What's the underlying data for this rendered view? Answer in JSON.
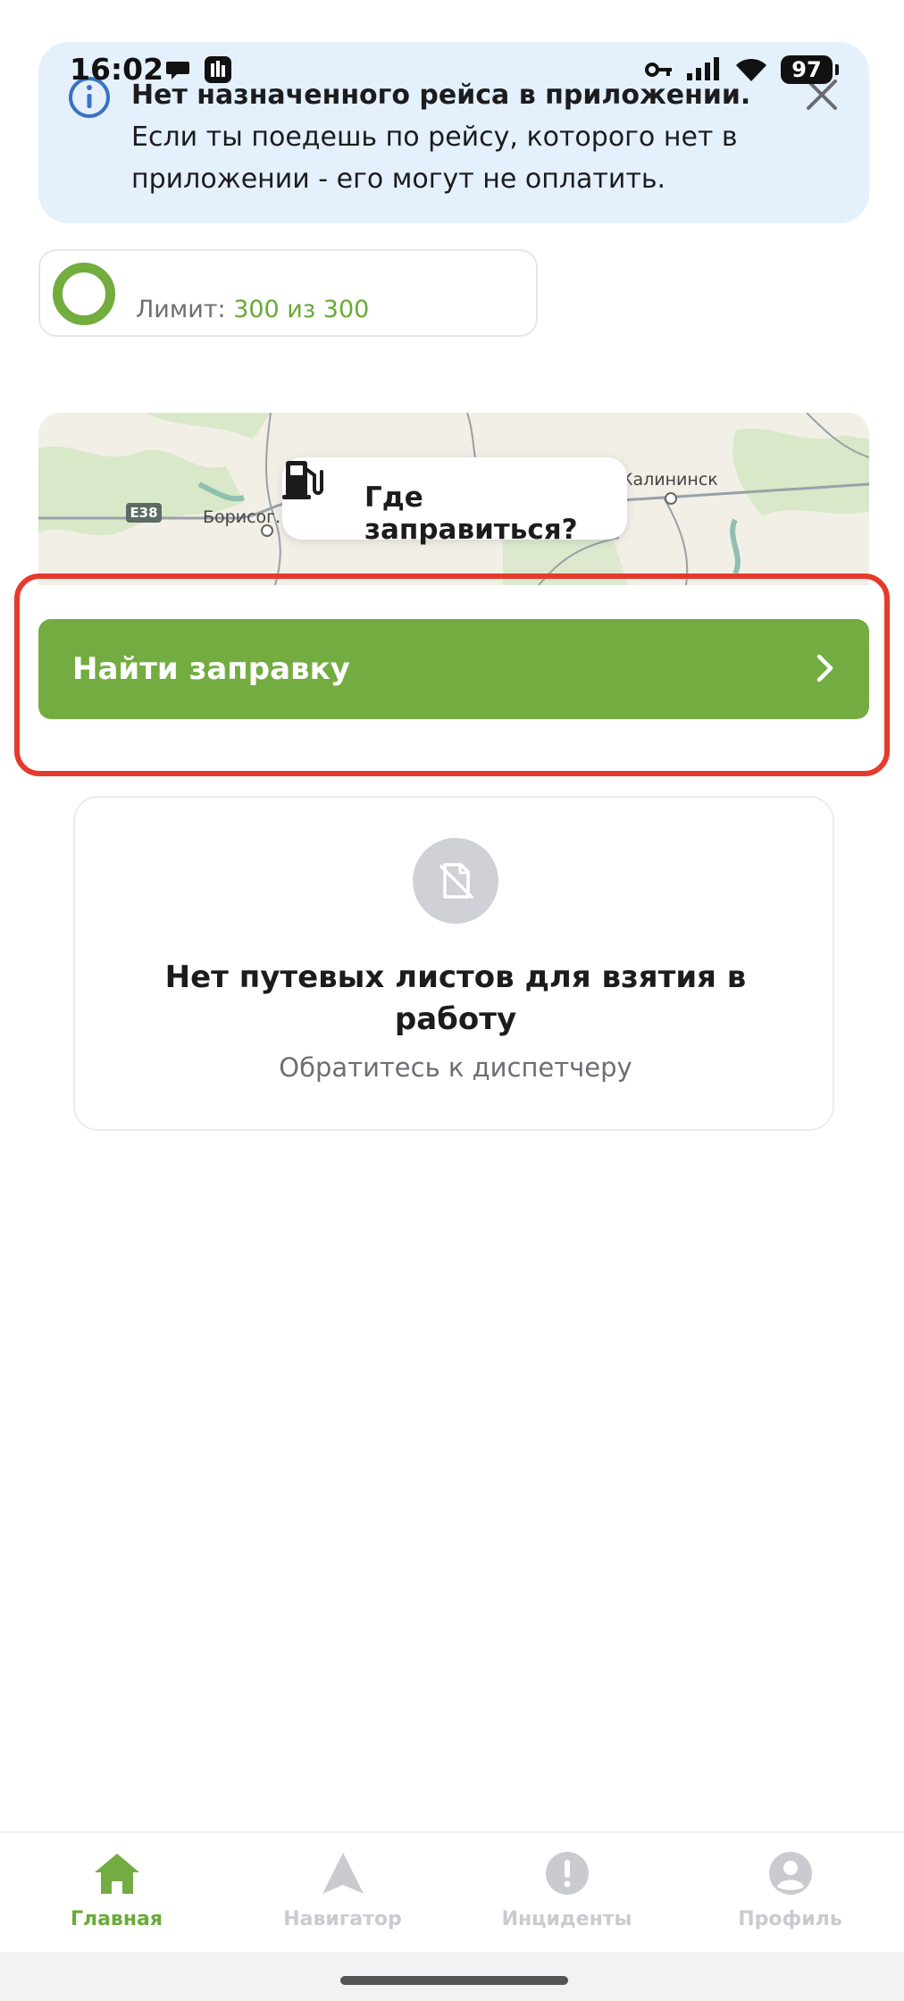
{
  "status_bar": {
    "time": "16:02",
    "battery": "97"
  },
  "banner": {
    "title": "Нет назначенного рейса в приложении.",
    "body": "Если ты поедешь по рейсу, которого нет в приложении - его могут не оплатить.",
    "icon": "info-icon",
    "close_icon": "close-icon"
  },
  "limit": {
    "label": "Лимит:",
    "value": "300 из 300",
    "progress_fraction": 1.0
  },
  "map": {
    "chip_label": "Где заправиться?",
    "chip_icon": "fuel-pump-icon",
    "places": [
      "Борисог.",
      "Калининск"
    ],
    "road": "E38"
  },
  "find_button": {
    "label": "Найти заправку"
  },
  "empty_state": {
    "title": "Нет путевых листов для взятия в работу",
    "subtitle": "Обратитесь к диспетчеру",
    "icon": "no-document-icon"
  },
  "nav": {
    "items": [
      {
        "label": "Главная",
        "icon": "home-icon",
        "active": true
      },
      {
        "label": "Навигатор",
        "icon": "navigation-arrow-icon",
        "active": false
      },
      {
        "label": "Инциденты",
        "icon": "alert-icon",
        "active": false
      },
      {
        "label": "Профиль",
        "icon": "profile-icon",
        "active": false
      }
    ]
  },
  "colors": {
    "accent": "#73ac41",
    "banner_bg": "#e4f0fc",
    "highlight": "#e53b2c",
    "nav_inactive": "#c9cbd0"
  }
}
